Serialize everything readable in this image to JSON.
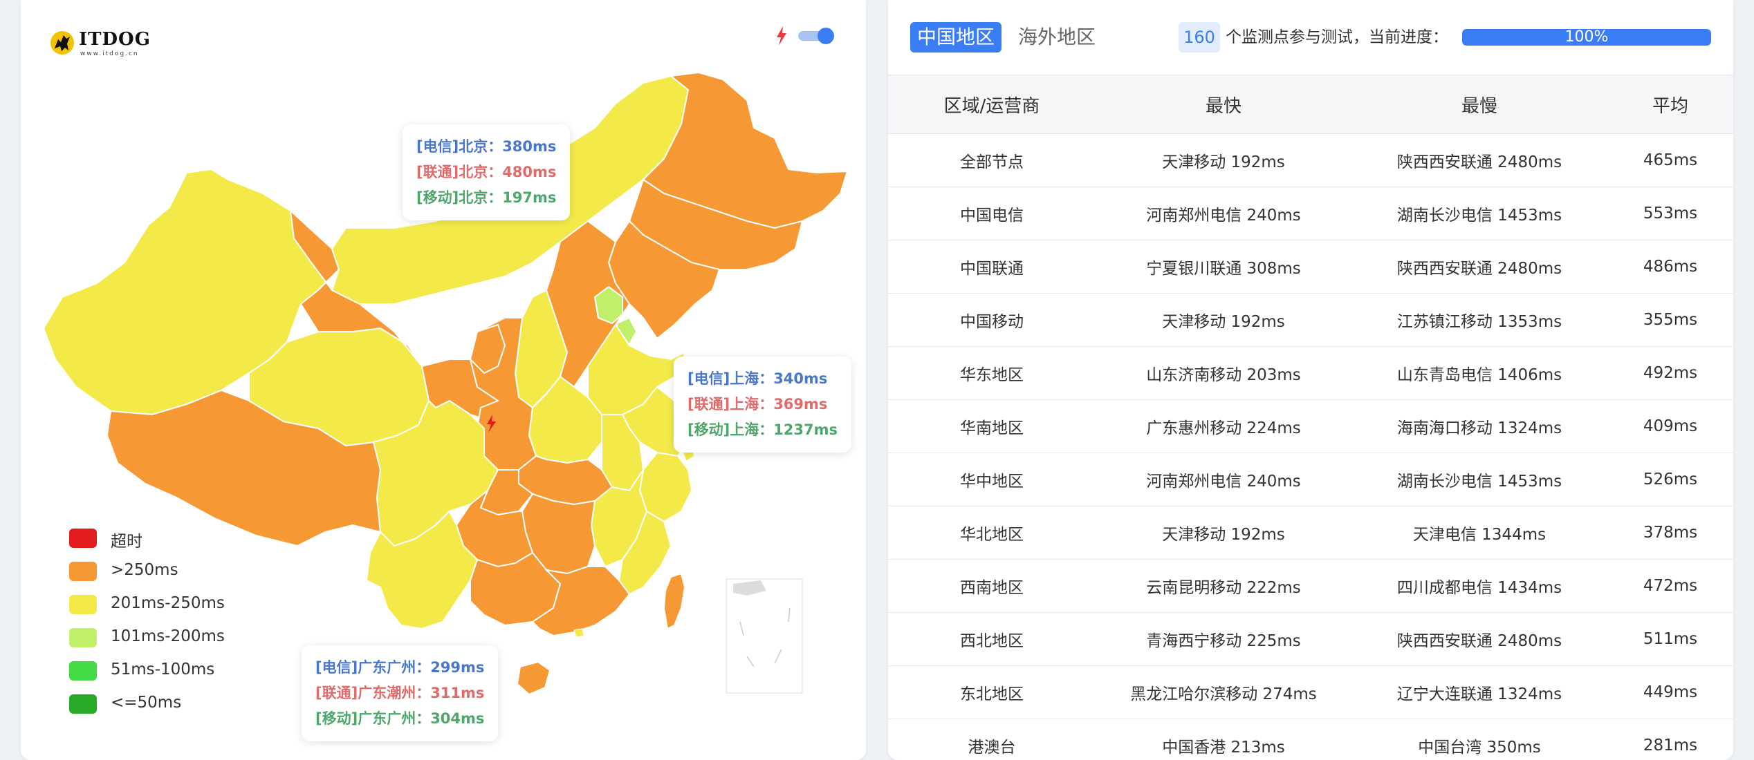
{
  "logo": {
    "text": "ITDOG",
    "sub": "www.itdog.cn"
  },
  "colors": {
    "timeout": "#e31d1d",
    "gt250": "#f69833",
    "r201_250": "#f3ea49",
    "r101_200": "#c0f06a",
    "r51_100": "#44db44",
    "le50": "#28a928",
    "accent": "#3b7df5"
  },
  "map": {
    "toggle_icon": "lightning-icon",
    "tooltips": {
      "beijing": {
        "tel": "[电信]北京：380ms",
        "uni": "[联通]北京：480ms",
        "mob": "[移动]北京：197ms"
      },
      "shanghai": {
        "tel": "[电信]上海：340ms",
        "uni": "[联通]上海：369ms",
        "mob": "[移动]上海：1237ms"
      },
      "guangdong": {
        "tel": "[电信]广东广州：299ms",
        "uni": "[联通]广东潮州：311ms",
        "mob": "[移动]广东广州：304ms"
      }
    },
    "legend": [
      {
        "label": "超时",
        "color": "#e31d1d"
      },
      {
        "label": ">250ms",
        "color": "#f69833"
      },
      {
        "label": "201ms-250ms",
        "color": "#f3ea49"
      },
      {
        "label": "101ms-200ms",
        "color": "#c0f06a"
      },
      {
        "label": "51ms-100ms",
        "color": "#44db44"
      },
      {
        "label": "<=50ms",
        "color": "#28a928"
      }
    ]
  },
  "tabs": {
    "domestic": "中国地区",
    "overseas": "海外地区"
  },
  "status": {
    "count": "160",
    "text": "个监测点参与测试，当前进度：",
    "progress_label": "100%",
    "progress_fraction": 1.0
  },
  "table": {
    "headers": [
      "区域/运营商",
      "最快",
      "最慢",
      "平均"
    ],
    "rows": [
      [
        "全部节点",
        "天津移动 192ms",
        "陕西西安联通 2480ms",
        "465ms"
      ],
      [
        "中国电信",
        "河南郑州电信 240ms",
        "湖南长沙电信 1453ms",
        "553ms"
      ],
      [
        "中国联通",
        "宁夏银川联通 308ms",
        "陕西西安联通 2480ms",
        "486ms"
      ],
      [
        "中国移动",
        "天津移动 192ms",
        "江苏镇江移动 1353ms",
        "355ms"
      ],
      [
        "华东地区",
        "山东济南移动 203ms",
        "山东青岛电信 1406ms",
        "492ms"
      ],
      [
        "华南地区",
        "广东惠州移动 224ms",
        "海南海口移动 1324ms",
        "409ms"
      ],
      [
        "华中地区",
        "河南郑州电信 240ms",
        "湖南长沙电信 1453ms",
        "526ms"
      ],
      [
        "华北地区",
        "天津移动 192ms",
        "天津电信 1344ms",
        "378ms"
      ],
      [
        "西南地区",
        "云南昆明移动 222ms",
        "四川成都电信 1434ms",
        "472ms"
      ],
      [
        "西北地区",
        "青海西宁移动 225ms",
        "陕西西安联通 2480ms",
        "511ms"
      ],
      [
        "东北地区",
        "黑龙江哈尔滨移动 274ms",
        "辽宁大连联通 1324ms",
        "449ms"
      ],
      [
        "港澳台",
        "中国香港 213ms",
        "中国台湾 350ms",
        "281ms"
      ]
    ]
  }
}
